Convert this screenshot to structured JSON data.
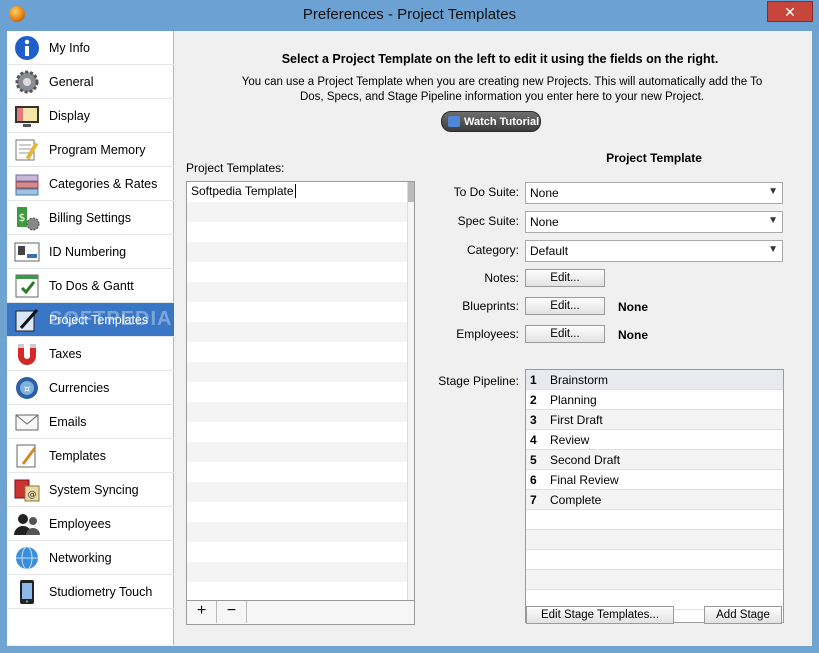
{
  "window": {
    "title": "Preferences - Project Templates",
    "close_glyph": "✕"
  },
  "sidebar": {
    "items": [
      {
        "label": "My Info",
        "icon": "info-icon"
      },
      {
        "label": "General",
        "icon": "gear-icon"
      },
      {
        "label": "Display",
        "icon": "monitor-icon"
      },
      {
        "label": "Program Memory",
        "icon": "memory-icon"
      },
      {
        "label": "Categories & Rates",
        "icon": "categories-icon"
      },
      {
        "label": "Billing Settings",
        "icon": "billing-icon"
      },
      {
        "label": "ID Numbering",
        "icon": "id-card-icon"
      },
      {
        "label": "To Dos & Gantt",
        "icon": "todo-icon"
      },
      {
        "label": "Project Templates",
        "icon": "project-templates-icon",
        "selected": true
      },
      {
        "label": "Taxes",
        "icon": "magnet-icon"
      },
      {
        "label": "Currencies",
        "icon": "currency-icon"
      },
      {
        "label": "Emails",
        "icon": "email-icon"
      },
      {
        "label": "Templates",
        "icon": "templates-icon"
      },
      {
        "label": "System Syncing",
        "icon": "sync-icon"
      },
      {
        "label": "Employees",
        "icon": "employees-icon"
      },
      {
        "label": "Networking",
        "icon": "globe-icon"
      },
      {
        "label": "Studiometry Touch",
        "icon": "phone-icon"
      }
    ],
    "watermark": "SOFTPEDIA"
  },
  "header": {
    "headline": "Select a Project Template on the left to edit it using the fields on the right.",
    "description": "You can use a Project Template when you are creating new Projects. This will automatically add the To Dos, Specs, and Stage Pipeline information you enter here to your new Project.",
    "tutorial_button": "Watch Tutorial"
  },
  "templates_list": {
    "label": "Project Templates:",
    "items": [
      "Softpedia Template"
    ],
    "add_button": "+",
    "remove_button": "−"
  },
  "form": {
    "title": "Project Template",
    "todo_suite": {
      "label": "To Do Suite:",
      "value": "None"
    },
    "spec_suite": {
      "label": "Spec Suite:",
      "value": "None"
    },
    "category": {
      "label": "Category:",
      "value": "Default"
    },
    "notes": {
      "label": "Notes:",
      "button": "Edit..."
    },
    "blueprints": {
      "label": "Blueprints:",
      "button": "Edit...",
      "value": "None"
    },
    "employees": {
      "label": "Employees:",
      "button": "Edit...",
      "value": "None"
    },
    "stage_pipeline_label": "Stage Pipeline:",
    "stages": [
      {
        "num": "1",
        "name": "Brainstorm"
      },
      {
        "num": "2",
        "name": "Planning"
      },
      {
        "num": "3",
        "name": "First Draft"
      },
      {
        "num": "4",
        "name": "Review"
      },
      {
        "num": "5",
        "name": "Second Draft"
      },
      {
        "num": "6",
        "name": "Final Review"
      },
      {
        "num": "7",
        "name": "Complete"
      }
    ],
    "edit_stage_templates_button": "Edit Stage Templates...",
    "add_stage_button": "Add Stage"
  },
  "colors": {
    "selection": "#3a76c6",
    "titlebar": "#6ba2d3",
    "close": "#c7463c"
  }
}
